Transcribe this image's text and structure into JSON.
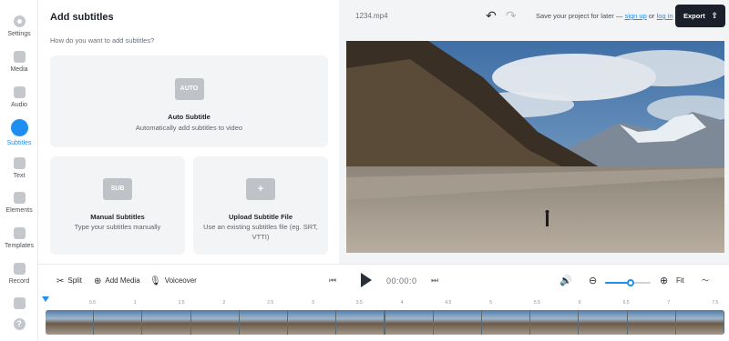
{
  "rail": {
    "items": [
      {
        "label": "Settings",
        "icon": "gear-icon"
      },
      {
        "label": "Media",
        "icon": "plus-icon"
      },
      {
        "label": "Audio",
        "icon": "music-icon"
      },
      {
        "label": "Subtitles",
        "icon": "subtitles-icon",
        "active": true
      },
      {
        "label": "Text",
        "icon": "text-icon"
      },
      {
        "label": "Elements",
        "icon": "elements-icon"
      },
      {
        "label": "Templates",
        "icon": "templates-icon"
      },
      {
        "label": "Record",
        "icon": "record-icon"
      },
      {
        "label": "",
        "icon": "keyboard-icon"
      },
      {
        "label": "",
        "icon": "help-icon"
      }
    ]
  },
  "panel": {
    "title": "Add subtitles",
    "subtitle": "How do you want to add subtitles?",
    "cards": {
      "auto": {
        "badge": "AUTO",
        "title": "Auto Subtitle",
        "desc": "Automatically add subtitles to video"
      },
      "manual": {
        "badge": "SUB",
        "title": "Manual Subtitles",
        "desc": "Type your subtitles manually"
      },
      "upload": {
        "badge": "+",
        "title": "Upload Subtitle File",
        "desc": "Use an existing subtitles file (eg. SRT, VTTI)"
      }
    }
  },
  "header": {
    "filename": "1234.mp4",
    "undo": "↶",
    "redo": "↷",
    "save_prefix": "Save your project for later —",
    "sign_up": "sign up",
    "or": "or",
    "log_in": "log in",
    "export": "Export",
    "export_icon": "⇪"
  },
  "toolbar": {
    "split": "Split",
    "add_media": "Add Media",
    "voiceover": "Voiceover",
    "time": "00:00:0",
    "fit": "Fit",
    "zoom_level": 0.55
  },
  "timeline": {
    "ticks": [
      "0.5",
      "1",
      "1.5",
      "2",
      "2.5",
      "3",
      "3.5",
      "4",
      "4.5",
      "5",
      "5.5",
      "6",
      "6.5",
      "7",
      "7.5"
    ]
  },
  "colors": {
    "accent": "#1f8ef1",
    "export_bg": "#1b1f2a"
  }
}
